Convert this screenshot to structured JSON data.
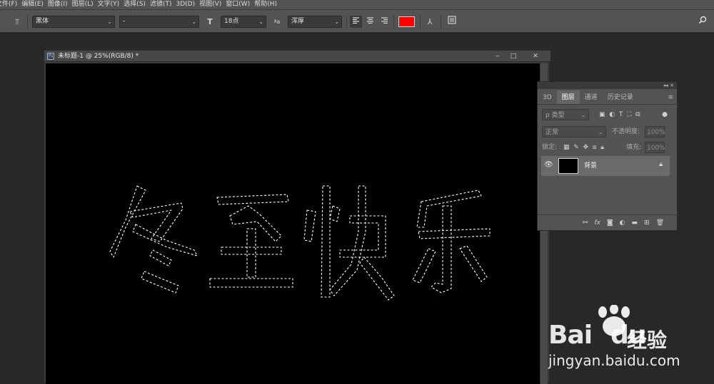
{
  "menubar": {
    "items": [
      "文件(F)",
      "编辑(E)",
      "图像(I)",
      "图层(L)",
      "文字(Y)",
      "选择(S)",
      "滤镜(T)",
      "3D(D)",
      "视图(V)",
      "窗口(W)",
      "帮助(H)"
    ]
  },
  "options": {
    "font_family": "黑体",
    "font_style": "-",
    "font_size": "18点",
    "aa_label": "ªa",
    "antialias": "浑厚",
    "text_color": "#ff0000",
    "size_icon": "T",
    "align_icons": [
      "align-left-icon",
      "align-center-icon",
      "align-right-icon"
    ]
  },
  "document": {
    "title": "未标题-1 @ 25%(RGB/8) *",
    "ps_icon": "Ps",
    "min": "‒",
    "max": "□",
    "close": "✕"
  },
  "layers_panel": {
    "tabs": [
      "3D",
      "图层",
      "通道",
      "历史记录"
    ],
    "active_tab": "图层",
    "filter_label": "ρ 类型",
    "blend_mode": "正常",
    "opacity_label": "不透明度:",
    "opacity_value": "100%",
    "lock_label": "锁定:",
    "fill_label": "填充:",
    "fill_value": "100%",
    "layer_name": "背景"
  },
  "watermark": {
    "brand": "Bai",
    "brand_suffix": "du",
    "cn": "经验",
    "url": "jingyan.baidu.com"
  }
}
